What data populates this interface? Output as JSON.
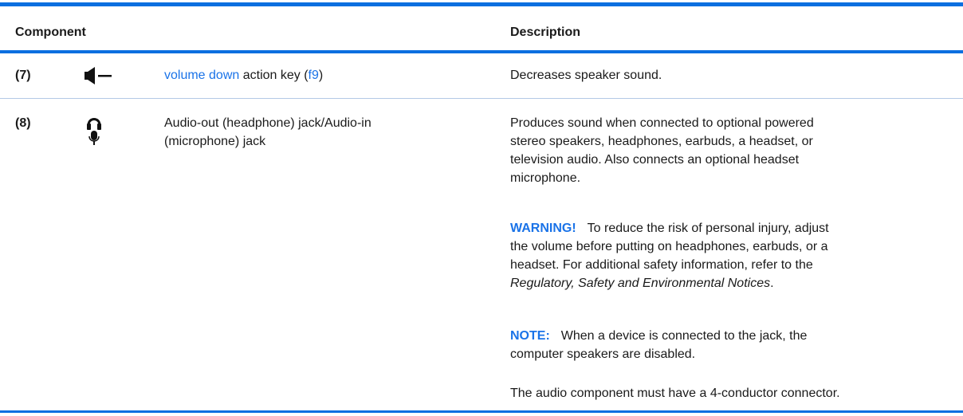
{
  "header": {
    "component": "Component",
    "description": "Description"
  },
  "rows": [
    {
      "number": "(7)",
      "icon": "volume-down-icon",
      "name_link": "volume down",
      "name_mid": " action key (",
      "name_key": "f9",
      "name_end": ")",
      "description": "Decreases speaker sound."
    },
    {
      "number": "(8)",
      "icon": "headset-microphone-icon",
      "name_line1": "Audio-out (headphone) jack/Audio-in",
      "name_line2": "(microphone) jack",
      "desc_lines": [
        "Produces sound when connected to optional powered",
        "stereo speakers, headphones, earbuds, a headset, or",
        "television audio. Also connects an optional headset",
        "microphone."
      ],
      "warning": {
        "label": "WARNING!",
        "line1": "To reduce the risk of personal injury, adjust",
        "line2": "the volume before putting on headphones, earbuds, or a",
        "line3": "headset. For additional safety information, refer to the",
        "line4_italic": "Regulatory, Safety and Environmental Notices",
        "line4_end": "."
      },
      "note": {
        "label": "NOTE:",
        "line1": "When a device is connected to the jack, the",
        "line2": "computer speakers are disabled."
      },
      "final": "The audio component must have a 4-conductor connector."
    }
  ],
  "colors": {
    "accent": "#0b6fe0",
    "link": "#1a73e8"
  }
}
